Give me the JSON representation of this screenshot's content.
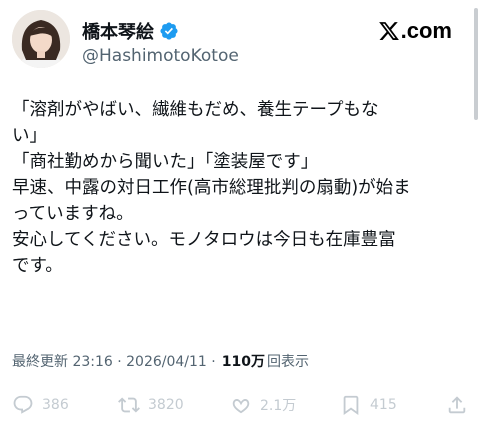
{
  "author": {
    "display_name": "橋本琴絵",
    "handle": "@HashimotoKotoe",
    "verified": true
  },
  "brand": {
    "label": ".com"
  },
  "tweet": {
    "lines": [
      "「溶剤がやばい、繊維もだめ、養生テープもな",
      "い」",
      "「商社勤めから聞いた」「塗装屋です」",
      "早速、中露の対日工作(高市総理批判の扇動)が始ま",
      "っていますね。",
      "安心してください。モノタロウは今日も在庫豊富",
      "です。"
    ]
  },
  "meta": {
    "timestamp": "最終更新 23:16 · 2026/04/11 · ",
    "views_count": "110万",
    "views_label": "回表示"
  },
  "actions": {
    "replies": "386",
    "reposts": "3820",
    "likes": "2.1万",
    "bookmarks": "415"
  },
  "colors": {
    "verified_badge": "#1d9bf0",
    "text_primary": "#0f1419",
    "text_secondary": "#536471",
    "action_icons": "#c4cbd1"
  },
  "icons": [
    "verified-badge-icon",
    "x-logo-icon",
    "reply-icon",
    "repost-icon",
    "like-icon",
    "bookmark-icon",
    "share-icon"
  ]
}
